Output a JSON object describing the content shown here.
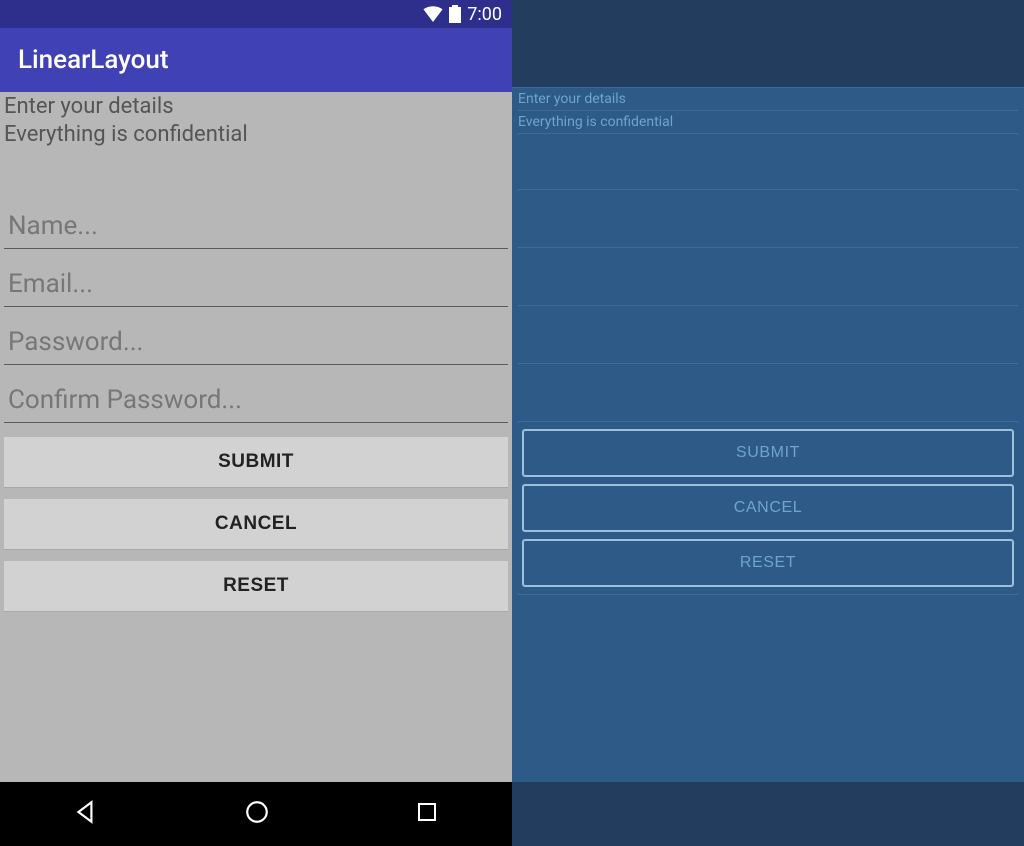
{
  "statusBar": {
    "time": "7:00"
  },
  "appBar": {
    "title": "LinearLayout"
  },
  "hints": {
    "line1": "Enter your details",
    "line2": "Everything is confidential"
  },
  "fields": {
    "name": {
      "placeholder": "Name...",
      "value": ""
    },
    "email": {
      "placeholder": "Email...",
      "value": ""
    },
    "password": {
      "placeholder": "Password...",
      "value": ""
    },
    "confirm": {
      "placeholder": "Confirm Password...",
      "value": ""
    }
  },
  "buttons": {
    "submit": "SUBMIT",
    "cancel": "CANCEL",
    "reset": "RESET"
  }
}
